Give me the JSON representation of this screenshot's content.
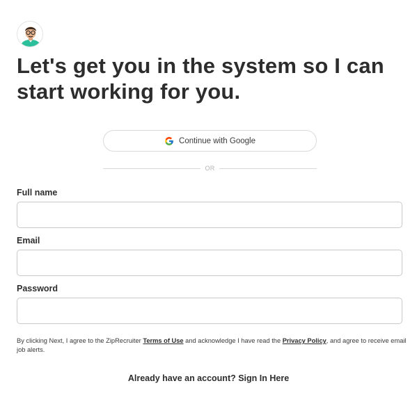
{
  "avatar": {
    "icon": "recruiter-avatar-icon"
  },
  "headline": "Let's get you in the system so I can start working for you.",
  "google_button": {
    "label": "Continue with Google",
    "icon": "google-g-icon"
  },
  "divider": {
    "text": "OR"
  },
  "form": {
    "full_name": {
      "label": "Full name",
      "value": "",
      "placeholder": ""
    },
    "email": {
      "label": "Email",
      "value": "",
      "placeholder": ""
    },
    "password": {
      "label": "Password",
      "value": "",
      "placeholder": ""
    }
  },
  "legal": {
    "part1": "By clicking Next, I agree to the ZipRecruiter ",
    "terms_link": "Terms of Use",
    "part2": " and acknowledge I have read the ",
    "privacy_link": "Privacy Policy",
    "part3": ", and agree to receive email job alerts."
  },
  "signin_link": "Already have an account? Sign In Here",
  "colors": {
    "text": "#2d2d2d",
    "border": "#c9c9c9",
    "avatar_shirt": "#2bbf9b",
    "google_blue": "#4285F4",
    "google_red": "#EA4335",
    "google_yellow": "#FBBC05",
    "google_green": "#34A853"
  }
}
